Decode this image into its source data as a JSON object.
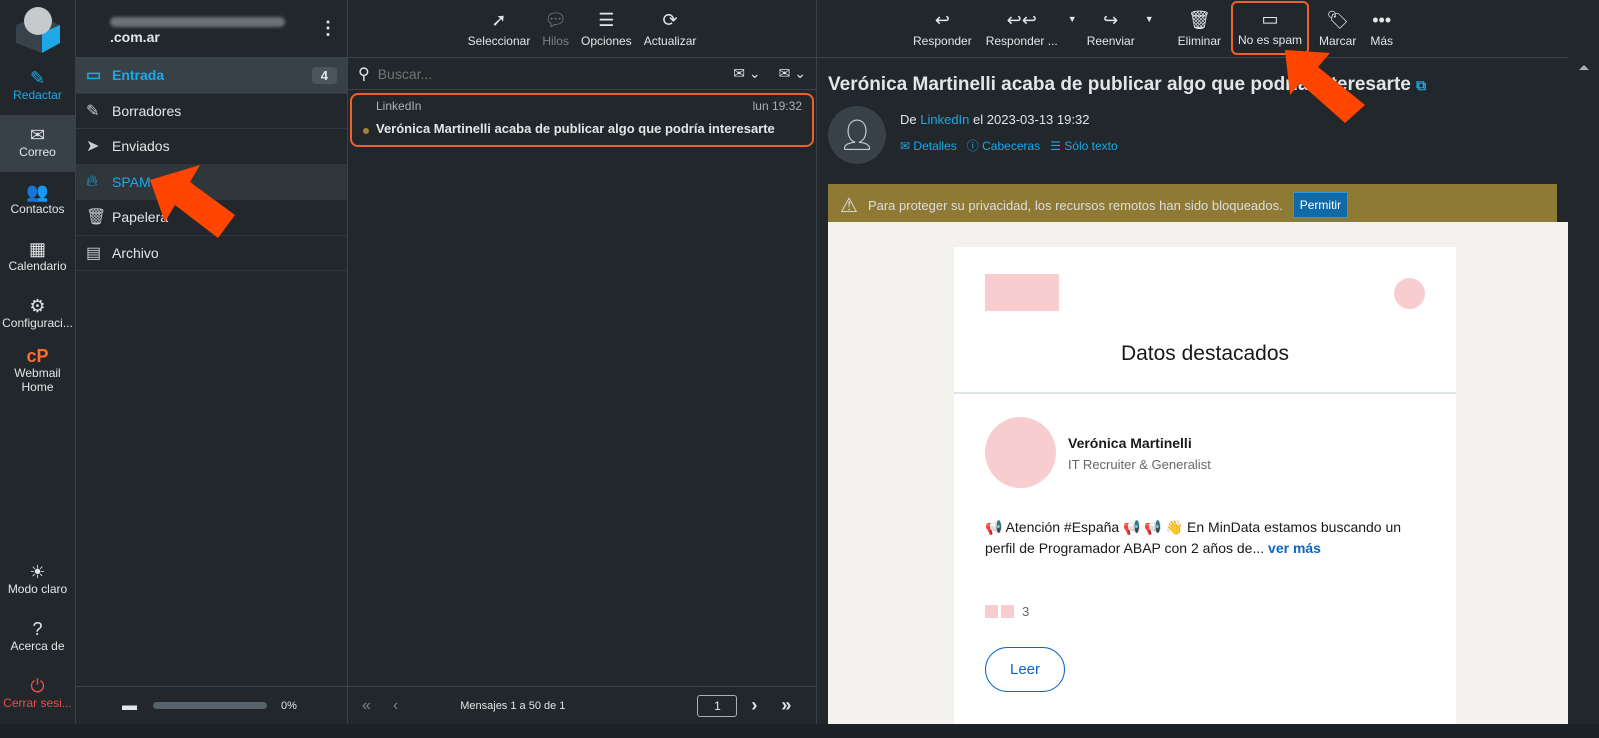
{
  "nav": [
    {
      "label": "Redactar",
      "icon": "compose-icon"
    },
    {
      "label": "Correo",
      "icon": "mail-icon"
    },
    {
      "label": "Contactos",
      "icon": "contacts-icon"
    },
    {
      "label": "Calendario",
      "icon": "calendar-icon"
    },
    {
      "label": "Configuraci...",
      "icon": "gear-icon"
    },
    {
      "label": "Webmail Home",
      "icon": "cpanel-icon"
    }
  ],
  "nav_bottom": [
    {
      "label": "Modo claro"
    },
    {
      "label": "Acerca de"
    },
    {
      "label": "Cerrar sesi..."
    }
  ],
  "account": {
    "email_suffix": ".com.ar"
  },
  "folders": [
    {
      "label": "Entrada",
      "count": "4"
    },
    {
      "label": "Borradores"
    },
    {
      "label": "Enviados"
    },
    {
      "label": "SPAM"
    },
    {
      "label": "Papelera"
    },
    {
      "label": "Archivo"
    }
  ],
  "quota": "0%",
  "list_toolbar": {
    "select": "Seleccionar",
    "threads": "Hilos",
    "options": "Opciones",
    "refresh": "Actualizar"
  },
  "search": {
    "placeholder": "Buscar..."
  },
  "messages": [
    {
      "from": "LinkedIn",
      "date": "lun 19:32",
      "subject": "Verónica Martinelli acaba de publicar algo que podría interesarte"
    }
  ],
  "pager": {
    "text": "Mensajes 1 a 50 de 1",
    "page": "1"
  },
  "msg_toolbar": {
    "reply": "Responder",
    "reply_all": "Responder ...",
    "forward": "Reenviar",
    "delete": "Eliminar",
    "not_spam": "No es spam",
    "mark": "Marcar",
    "more": "Más"
  },
  "message": {
    "subject": "Verónica Martinelli acaba de publicar algo que podría interesarte",
    "from_prefix": "De",
    "from": "LinkedIn",
    "date_prefix": "el",
    "date": "2023-03-13 19:32",
    "details": "Detalles",
    "headers": "Cabeceras",
    "plain": "Sólo texto"
  },
  "warning": {
    "text": "Para proteger su privacidad, los recursos remotos han sido bloqueados.",
    "button": "Permitir"
  },
  "email": {
    "heading": "Datos destacados",
    "name": "Verónica Martinelli",
    "role": "IT Recruiter & Generalist",
    "post": "📢 Atención #España 📢 📢  👋 En MinData estamos buscando un perfil de Programador ABAP con 2 años de...",
    "more": "ver más",
    "reactions": "3",
    "read": "Leer"
  }
}
